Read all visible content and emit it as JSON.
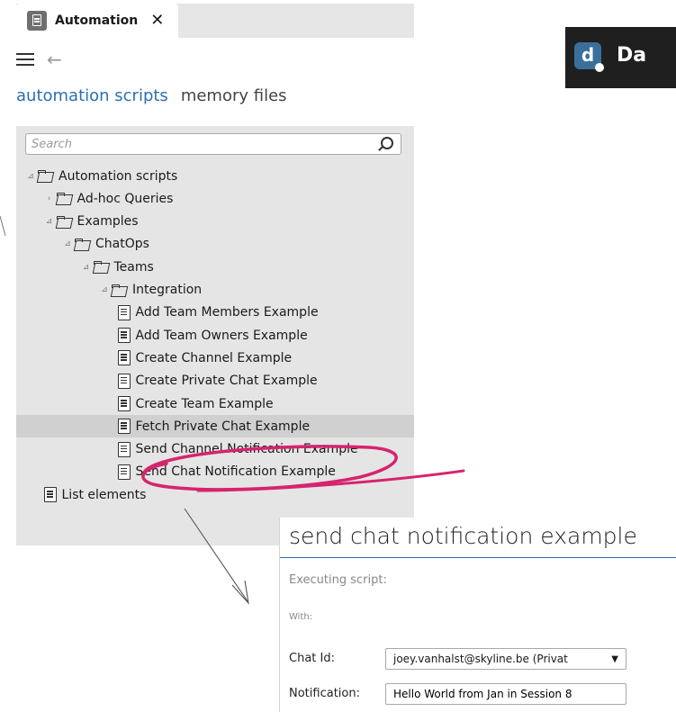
{
  "window": {
    "tab_title": "Automation",
    "close_glyph": "✕"
  },
  "nav": {
    "back_glyph": "←"
  },
  "subtabs": {
    "active": "automation scripts",
    "inactive": "memory files"
  },
  "search": {
    "placeholder": "Search"
  },
  "tree": [
    {
      "label": "Automation scripts",
      "type": "folder",
      "expander": "⊿",
      "indent": 0
    },
    {
      "label": "Ad-hoc Queries",
      "type": "folder",
      "expander": "›",
      "indent": 1
    },
    {
      "label": "Examples",
      "type": "folder",
      "expander": "⊿",
      "indent": 1
    },
    {
      "label": "ChatOps",
      "type": "folder",
      "expander": "⊿",
      "indent": 2
    },
    {
      "label": "Teams",
      "type": "folder",
      "expander": "⊿",
      "indent": 3
    },
    {
      "label": "Integration",
      "type": "folder",
      "expander": "⊿",
      "indent": 4
    },
    {
      "label": "Add Team Members Example",
      "type": "script",
      "indent": 5
    },
    {
      "label": "Add Team Owners Example",
      "type": "script",
      "indent": 5
    },
    {
      "label": "Create Channel Example",
      "type": "script",
      "indent": 5
    },
    {
      "label": "Create Private Chat Example",
      "type": "script",
      "indent": 5
    },
    {
      "label": "Create Team Example",
      "type": "script",
      "indent": 5
    },
    {
      "label": "Fetch Private Chat Example",
      "type": "script",
      "indent": 5,
      "selected": true
    },
    {
      "label": "Send Channel Notification Example",
      "type": "script",
      "indent": 5
    },
    {
      "label": "Send Chat Notification Example",
      "type": "script",
      "indent": 5
    },
    {
      "label": "List elements",
      "type": "script",
      "indent": 1
    }
  ],
  "dialog": {
    "title": "send chat notification example",
    "executing_label": "Executing script:",
    "with_label": "With:",
    "chat_id_label": "Chat Id:",
    "chat_id_value": "joey.vanhalst@skyline.be (Privat",
    "notification_label": "Notification:",
    "notification_value": "Hello World from Jan in Session 8"
  },
  "badge": {
    "logo_letter": "d",
    "text": "Da"
  },
  "annotation_color": "#d6246e",
  "icons": [
    "automation-app-icon",
    "close-icon",
    "hamburger-icon",
    "back-arrow-icon",
    "search-icon",
    "folder-icon",
    "script-icon",
    "dropdown-arrow-icon"
  ]
}
